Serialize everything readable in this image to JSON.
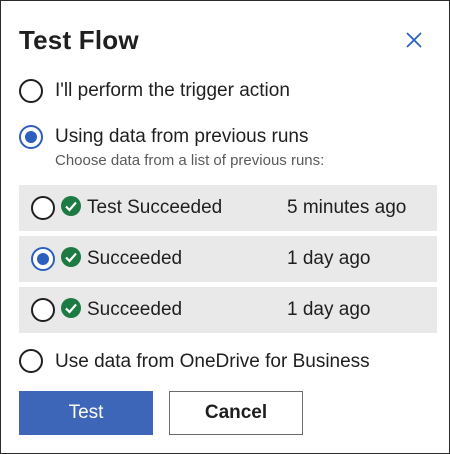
{
  "dialog": {
    "title": "Test Flow",
    "close_icon": "close-icon"
  },
  "options": [
    {
      "label": "I'll perform the trigger action",
      "selected": false
    },
    {
      "label": "Using data from previous runs",
      "selected": true,
      "sublabel": "Choose data from a list of previous runs:"
    },
    {
      "label": "Use data from OneDrive for Business",
      "selected": false
    }
  ],
  "runs": [
    {
      "status": "Test Succeeded",
      "time": "5 minutes ago",
      "selected": false,
      "status_icon": "check-circle-icon"
    },
    {
      "status": "Succeeded",
      "time": "1 day ago",
      "selected": true,
      "status_icon": "check-circle-icon"
    },
    {
      "status": "Succeeded",
      "time": "1 day ago",
      "selected": false,
      "status_icon": "check-circle-icon"
    }
  ],
  "buttons": {
    "test_label": "Test",
    "cancel_label": "Cancel"
  },
  "colors": {
    "accent": "#3d66b8",
    "radio_selected": "#2d5fbe",
    "success": "#1e7a43",
    "row_background": "#e9e9e9"
  }
}
